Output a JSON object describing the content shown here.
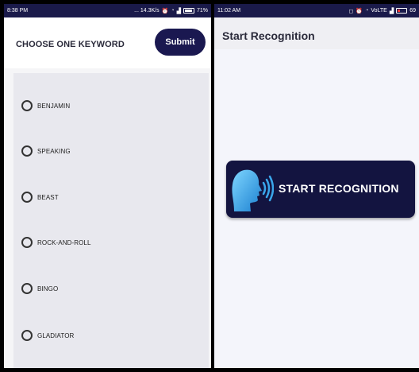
{
  "left_phone": {
    "status": {
      "time": "8:38 PM",
      "net": "... 14.3K/s",
      "battery": "71%"
    },
    "title": "CHOOSE ONE KEYWORD",
    "submit_label": "Submit",
    "options": [
      {
        "label": "BENJAMIN"
      },
      {
        "label": "SPEAKING"
      },
      {
        "label": "BEAST"
      },
      {
        "label": "ROCK-AND-ROLL"
      },
      {
        "label": "BINGO"
      },
      {
        "label": "GLADIATOR"
      }
    ]
  },
  "right_phone": {
    "status": {
      "time": "11:02 AM",
      "net": "VoLTE",
      "battery": "69"
    },
    "title": "Start Recognition",
    "button_label": "START RECOGNITION",
    "button_icon": "speaking-head-icon"
  },
  "colors": {
    "primary": "#1a1850",
    "status_bar": "#1a1a4a",
    "panel": "#e8e8ee"
  }
}
